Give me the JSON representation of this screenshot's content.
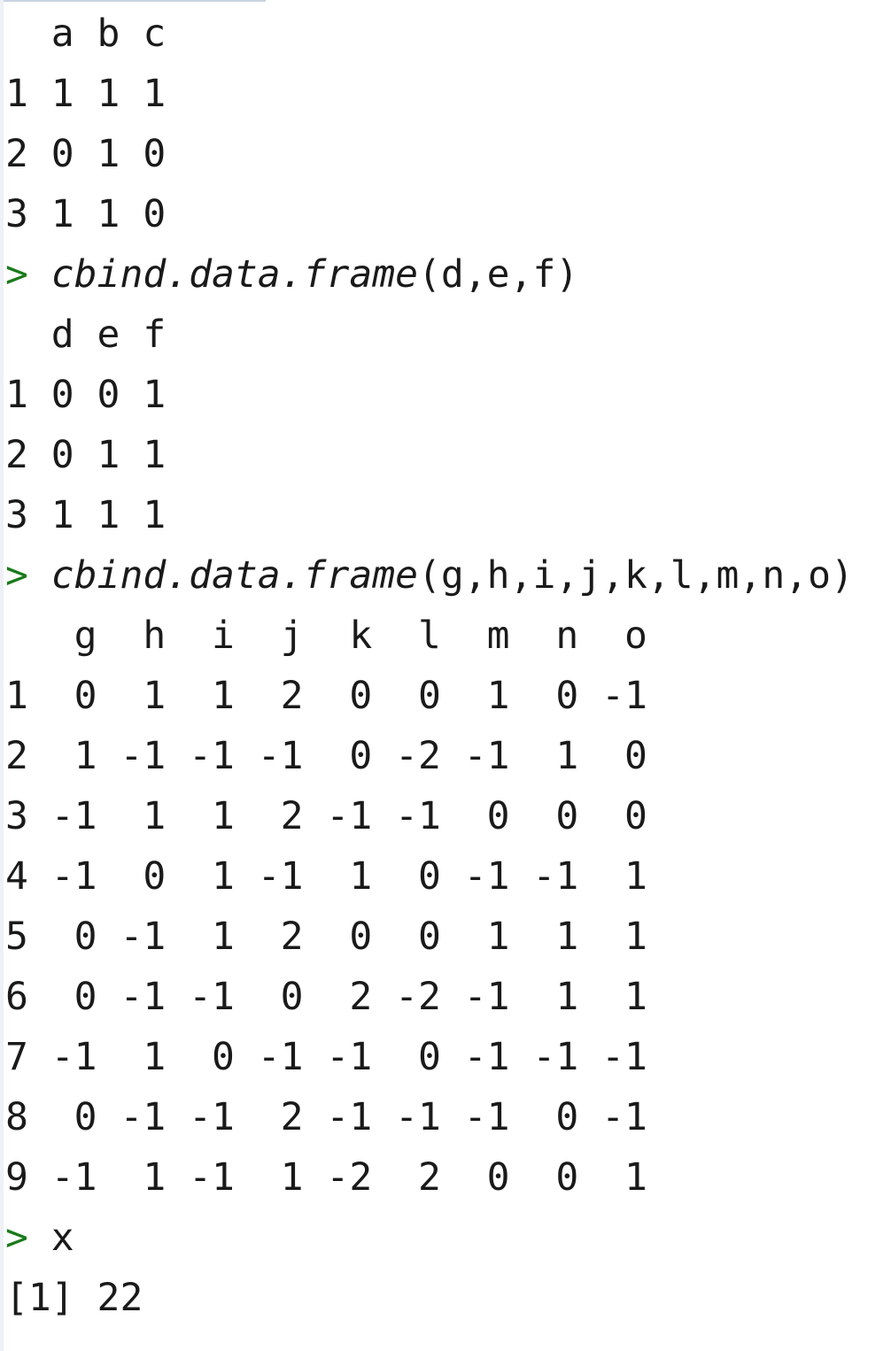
{
  "console": {
    "prompt_symbol": ">",
    "blocks": [
      {
        "command": null,
        "output": [
          "  a b c",
          "1 1 1 1",
          "2 0 1 0",
          "3 1 1 0"
        ]
      },
      {
        "command": {
          "fn": "cbind.data.frame",
          "args": "(d,e,f)"
        },
        "output": [
          "  d e f",
          "1 0 0 1",
          "2 0 1 1",
          "3 1 1 1"
        ]
      },
      {
        "command": {
          "fn": "cbind.data.frame",
          "args": "(g,h,i,j,k,l,m,n,o)"
        },
        "output": [
          "   g  h  i  j  k  l  m  n  o",
          "1  0  1  1  2  0  0  1  0 -1",
          "2  1 -1 -1 -1  0 -2 -1  1  0",
          "3 -1  1  1  2 -1 -1  0  0  0",
          "4 -1  0  1 -1  1  0 -1 -1  1",
          "5  0 -1  1  2  0  0  1  1  1",
          "6  0 -1 -1  0  2 -2 -1  1  1",
          "7 -1  1  0 -1 -1  0 -1 -1 -1",
          "8  0 -1 -1  2 -1 -1 -1  0 -1",
          "9 -1  1 -1  1 -2  2  0  0  1"
        ]
      },
      {
        "command": {
          "fn": "x",
          "args": ""
        },
        "output": [
          "[1] 22"
        ]
      }
    ]
  }
}
